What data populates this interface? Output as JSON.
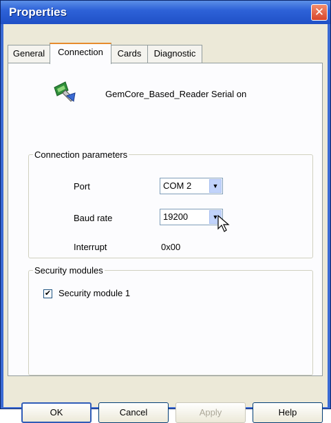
{
  "window": {
    "title": "Properties"
  },
  "tabs": [
    {
      "label": "General"
    },
    {
      "label": "Connection"
    },
    {
      "label": "Cards"
    },
    {
      "label": "Diagnostic"
    }
  ],
  "reader": {
    "label": "GemCore_Based_Reader  Serial on",
    "icon": "reader-icon"
  },
  "connection_group": {
    "legend": "Connection parameters",
    "port_label": "Port",
    "port_value": "COM 2",
    "baud_label": "Baud rate",
    "baud_value": "19200",
    "interrupt_label": "Interrupt",
    "interrupt_value": "0x00"
  },
  "security_group": {
    "legend": "Security modules",
    "module1_label": "Security module 1",
    "module1_checked": true
  },
  "buttons": {
    "ok": "OK",
    "cancel": "Cancel",
    "apply": "Apply",
    "help": "Help"
  },
  "colors": {
    "titlebar": "#2e62d8",
    "dialog": "#ece9d8",
    "close": "#d8452a"
  }
}
